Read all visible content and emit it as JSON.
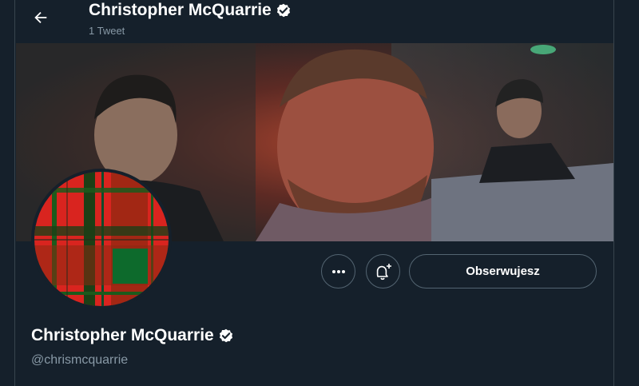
{
  "header": {
    "back_icon": "arrow-left-icon",
    "title": "Christopher McQuarrie",
    "tweet_count": "1 Tweet"
  },
  "profile": {
    "name": "Christopher McQuarrie",
    "handle": "@chrismcquarrie",
    "verified_icon": "verified-badge-icon",
    "avatar": "red-tartan-avatar",
    "banner": "movie-still-banner"
  },
  "actions": {
    "more_icon": "more-dots-icon",
    "notify_icon": "bell-plus-icon",
    "follow_label": "Obserwujesz"
  },
  "colors": {
    "background": "#15202b",
    "border": "#38444d",
    "secondary_text": "#8899a6",
    "button_border": "#536471"
  }
}
